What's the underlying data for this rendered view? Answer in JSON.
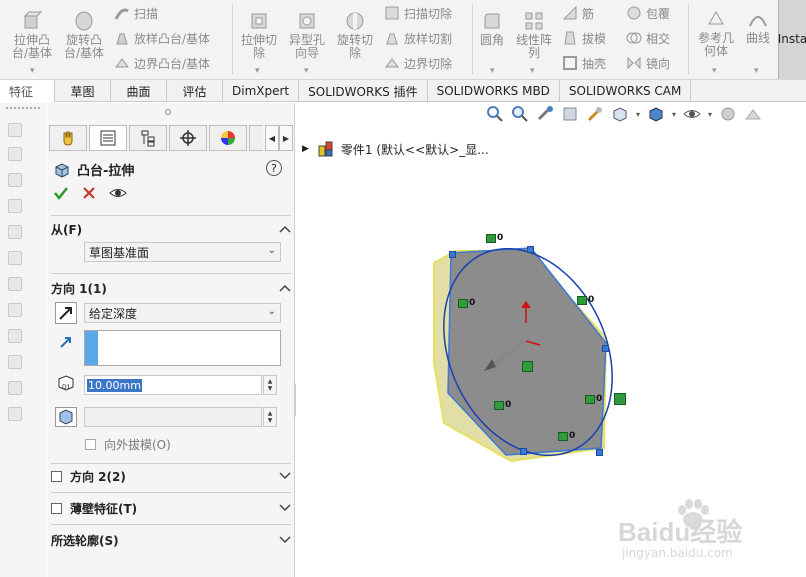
{
  "ribbon": {
    "extrude_boss": "拉伸凸\n台/基体",
    "revolve_boss": "旋转凸\n台/基体",
    "sweep": "扫描",
    "loft": "放样凸台/基体",
    "boundary": "边界凸台/基体",
    "extruded_cut": "拉伸切\n除",
    "hole_wizard": "异型孔\n向导",
    "revolved_cut": "旋转切\n除",
    "swept_cut": "扫描切除",
    "lofted_cut": "放样切割",
    "boundary_cut": "边界切除",
    "fillet": "圆角",
    "linear_pattern": "线性阵\n列",
    "rib": "筋",
    "draft": "拔模",
    "shell": "抽壳",
    "wrap": "包覆",
    "intersect": "相交",
    "mirror": "镜向",
    "ref_geometry": "参考几\n何体",
    "curves": "曲线",
    "instant3d": "Insta"
  },
  "tabs": [
    "特征",
    "草图",
    "曲面",
    "评估",
    "DimXpert",
    "SOLIDWORKS 插件",
    "SOLIDWORKS MBD",
    "SOLIDWORKS CAM"
  ],
  "pm": {
    "title": "凸台-拉伸",
    "help": "?",
    "from_label": "从(F)",
    "from_value": "草图基准面",
    "dir1_label": "方向 1(1)",
    "end_condition": "给定深度",
    "depth": "10.00mm",
    "draft_outward": "向外拔模(O)",
    "dir2_label": "方向 2(2)",
    "thin_label": "薄壁特征(T)",
    "contours_label": "所选轮廓(S)"
  },
  "viewport": {
    "tree_label": "零件1 (默认<<默认>_显...",
    "tag_label": "0"
  },
  "watermark": {
    "logo": "Baidu经验",
    "url": "jingyan.baidu.com"
  },
  "colors": {
    "accent": "#3a78d4",
    "face": "#8c8c8c",
    "preview_edge": "#e8e060",
    "tag": "#2f9b3c"
  }
}
